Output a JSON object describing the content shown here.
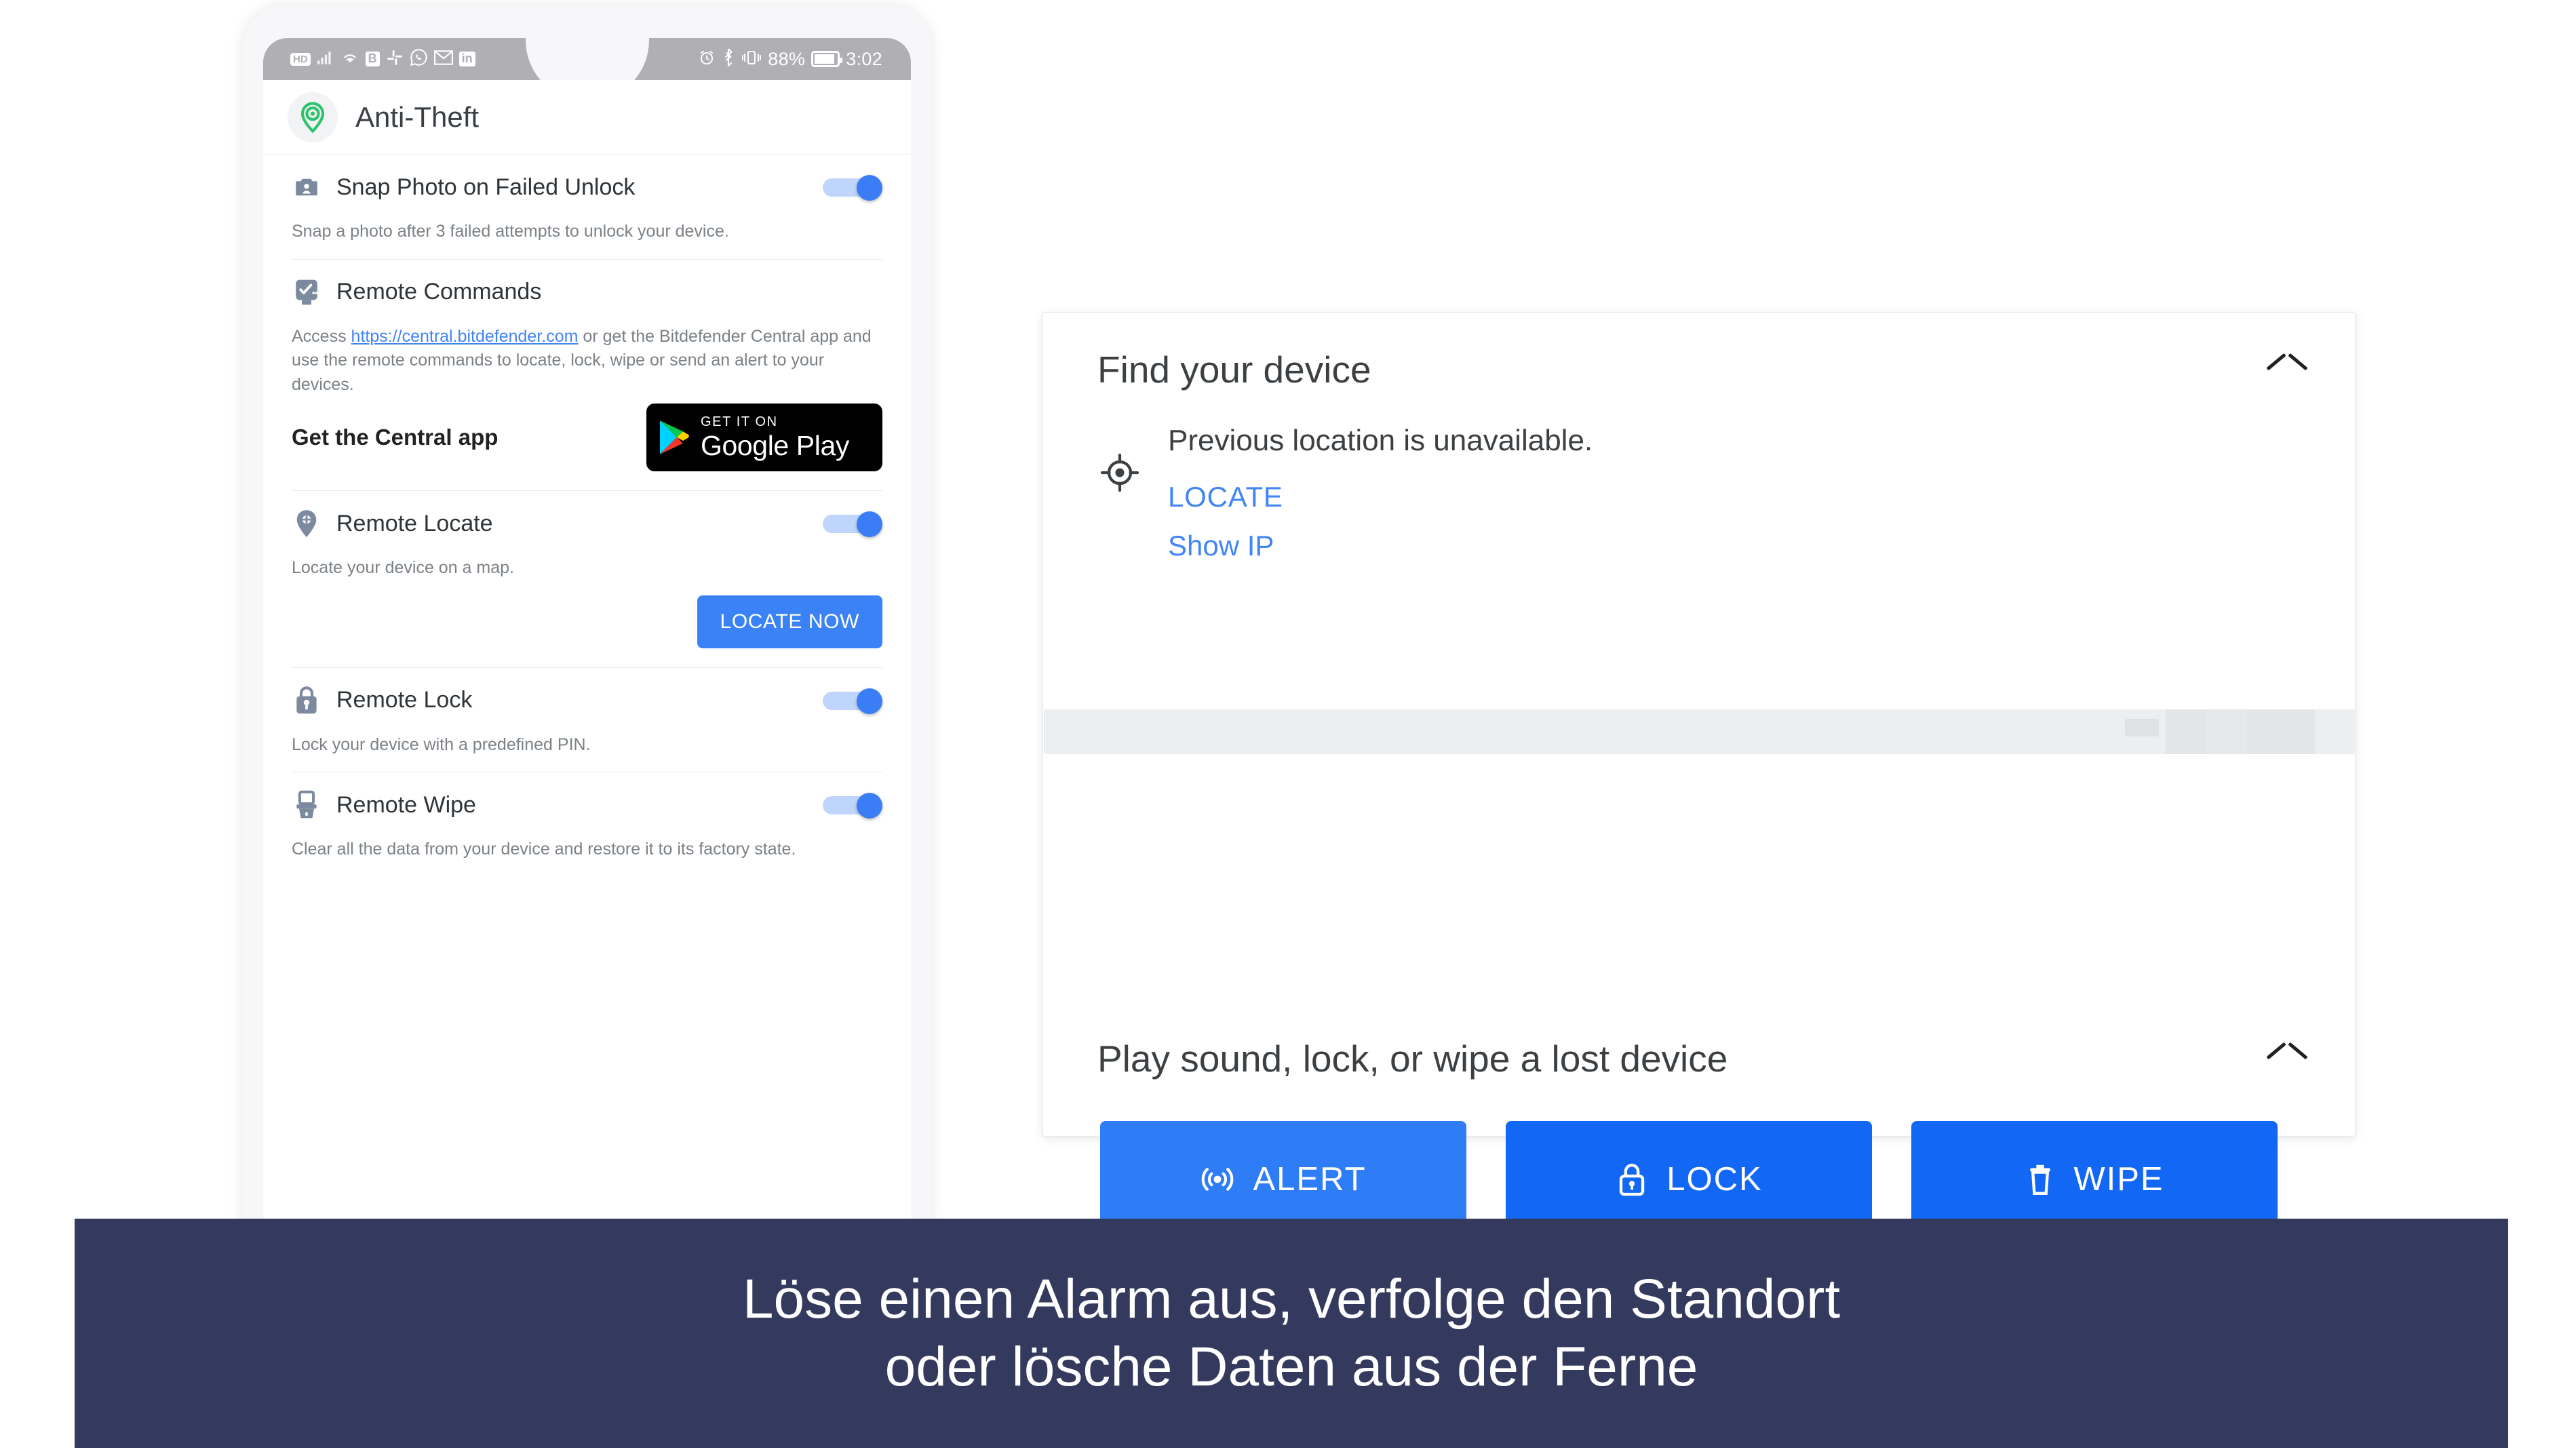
{
  "phone": {
    "status_bar": {
      "left_icons": [
        "hd-badge-icon",
        "signal-bars-icon",
        "wifi-icon",
        "b-badge-icon",
        "slack-icon",
        "whatsapp-icon",
        "mail-icon",
        "linkedin-badge-icon"
      ],
      "hd_label": "HD",
      "b_label": "B",
      "in_label": "in",
      "alarm_icon": "alarm-clock-icon",
      "bluetooth_icon": "bluetooth-icon",
      "vibrate_icon": "vibrate-icon",
      "battery_percent": "88%",
      "time": "3:02"
    },
    "app_header": {
      "icon": "location-pin-icon",
      "title": "Anti-Theft"
    },
    "rows": [
      {
        "icon": "camera-person-icon",
        "title": "Snap Photo on Failed Unlock",
        "desc": "Snap a photo after 3 failed attempts to unlock your device.",
        "toggle": "on"
      },
      {
        "icon": "remote-commands-icon",
        "title": "Remote Commands",
        "desc_pre": "Access ",
        "link": "https://central.bitdefender.com",
        "desc_post": " or get the Bitdefender Central app and use the remote commands to locate, lock, wipe or send an alert to your devices.",
        "cta_label": "Get the Central app",
        "badge": {
          "small": "GET IT ON",
          "large": "Google Play"
        }
      },
      {
        "icon": "locate-pin-icon",
        "title": "Remote Locate",
        "desc": "Locate your device on a map.",
        "toggle": "on",
        "button": "LOCATE NOW"
      },
      {
        "icon": "lock-key-icon",
        "title": "Remote Lock",
        "desc": "Lock your device with a predefined PIN.",
        "toggle": "on"
      },
      {
        "icon": "wipe-trash-icon",
        "title": "Remote Wipe",
        "desc": "Clear all the data from your device and restore it to its factory state.",
        "toggle": "on"
      }
    ]
  },
  "card": {
    "find_device": {
      "title": "Find your device",
      "collapse_icon": "chevron-up-icon",
      "location_icon": "crosshair-icon",
      "status_text": "Previous location is unavailable.",
      "locate_link": "LOCATE",
      "showip_link": "Show IP"
    },
    "play_sound": {
      "title": "Play sound, lock, or wipe a lost device",
      "collapse_icon": "chevron-up-icon",
      "buttons": [
        {
          "icon": "broadcast-icon",
          "label": "ALERT",
          "color": "#2e7df6"
        },
        {
          "icon": "padlock-icon",
          "label": "LOCK",
          "color": "#1367f5"
        },
        {
          "icon": "trash-icon",
          "label": "WIPE",
          "color": "#1367f5"
        }
      ]
    }
  },
  "caption": {
    "line1": "Löse einen Alarm aus, verfolge den Standort",
    "line2": "oder lösche Daten aus der Ferne",
    "background": "#343a5e"
  },
  "colors": {
    "accent_blue": "#3b82f6",
    "link_blue": "#4285f4",
    "toggle_on": "#3b7df4",
    "green": "#2ec26e"
  }
}
